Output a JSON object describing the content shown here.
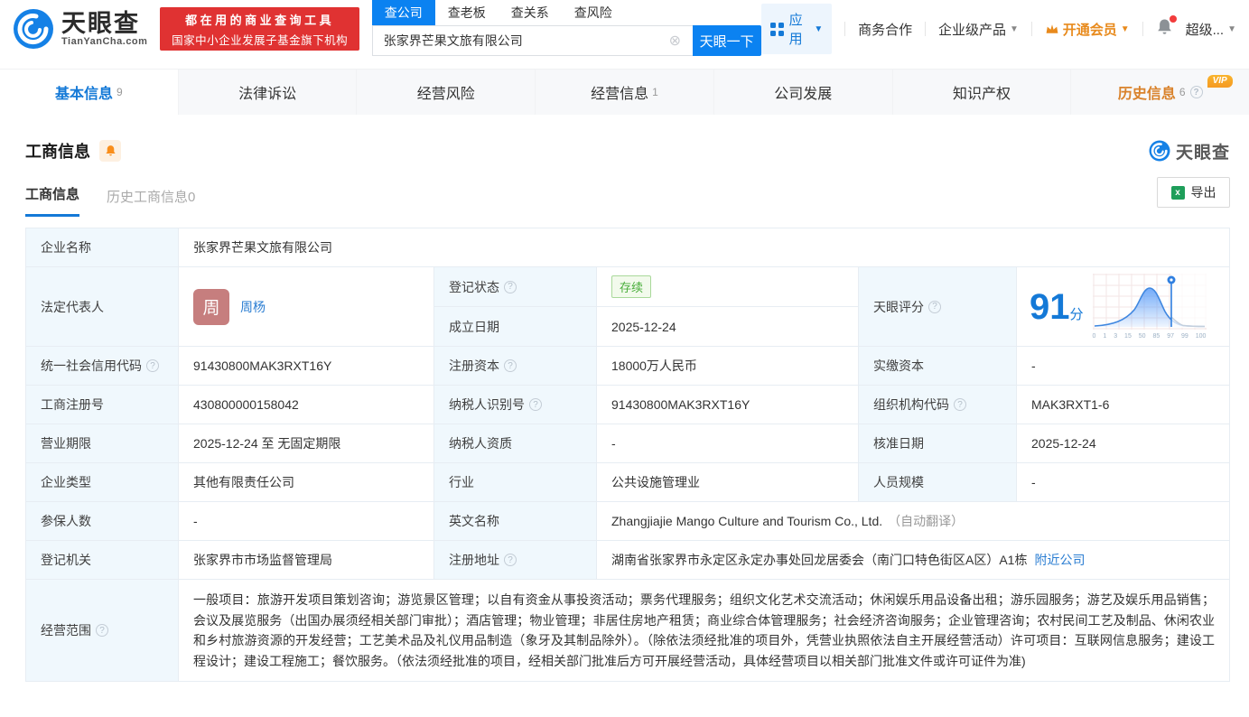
{
  "header": {
    "brand": {
      "name": "天眼查",
      "domain": "TianYanCha.com"
    },
    "promo": {
      "line1": "都在用的商业查询工具",
      "line2": "国家中小企业发展子基金旗下机构"
    },
    "search": {
      "tabs": [
        {
          "label": "查公司"
        },
        {
          "label": "查老板"
        },
        {
          "label": "查关系"
        },
        {
          "label": "查风险"
        }
      ],
      "value": "张家界芒果文旅有限公司",
      "button": "天眼一下"
    },
    "nav": {
      "apps": "应用",
      "biz_coop": "商务合作",
      "enterprise": "企业级产品",
      "vip": "开通会员",
      "super_vip": "超级..."
    }
  },
  "tabs": [
    {
      "label": "基本信息",
      "count": "9"
    },
    {
      "label": "法律诉讼",
      "count": ""
    },
    {
      "label": "经营风险",
      "count": ""
    },
    {
      "label": "经营信息",
      "count": "1"
    },
    {
      "label": "公司发展",
      "count": ""
    },
    {
      "label": "知识产权",
      "count": ""
    },
    {
      "label": "历史信息",
      "count": "6"
    }
  ],
  "vip_badge": "VIP",
  "section": {
    "title": "工商信息",
    "subtab_active": "工商信息",
    "subtab_history": "历史工商信息0",
    "export": "导出",
    "watermark": "天眼查",
    "excel_icon": "x"
  },
  "info": {
    "company_name_label": "企业名称",
    "company_name": "张家界芒果文旅有限公司",
    "legal_rep_label": "法定代表人",
    "legal_rep_avatar": "周",
    "legal_rep": "周杨",
    "reg_status_label": "登记状态",
    "reg_status": "存续",
    "est_date_label": "成立日期",
    "est_date": "2025-12-24",
    "score_label": "天眼评分",
    "score": {
      "value": "91",
      "unit": "分",
      "ticks": [
        "0",
        "1",
        "3",
        "15",
        "50",
        "85",
        "97",
        "99",
        "100"
      ]
    },
    "uscc_label": "统一社会信用代码",
    "uscc": "91430800MAK3RXT16Y",
    "reg_capital_label": "注册资本",
    "reg_capital": "18000万人民币",
    "paid_capital_label": "实缴资本",
    "paid_capital": "-",
    "reg_no_label": "工商注册号",
    "reg_no": "430800000158042",
    "taxpayer_id_label": "纳税人识别号",
    "taxpayer_id": "91430800MAK3RXT16Y",
    "org_code_label": "组织机构代码",
    "org_code": "MAK3RXT1-6",
    "biz_term_label": "营业期限",
    "biz_term": "2025-12-24 至 无固定期限",
    "taxpayer_qual_label": "纳税人资质",
    "taxpayer_qual": "-",
    "approval_date_label": "核准日期",
    "approval_date": "2025-12-24",
    "company_type_label": "企业类型",
    "company_type": "其他有限责任公司",
    "industry_label": "行业",
    "industry": "公共设施管理业",
    "staff_size_label": "人员规模",
    "staff_size": "-",
    "insured_label": "参保人数",
    "insured": "-",
    "en_name_label": "英文名称",
    "en_name": "Zhangjiajie Mango Culture and Tourism Co., Ltd.",
    "en_name_note": "（自动翻译）",
    "reg_authority_label": "登记机关",
    "reg_authority": "张家界市市场监督管理局",
    "reg_addr_label": "注册地址",
    "reg_addr": "湖南省张家界市永定区永定办事处回龙居委会（南门口特色街区A区）A1栋",
    "nearby_link": "附近公司",
    "scope_label": "经营范围",
    "scope": "一般项目：旅游开发项目策划咨询；游览景区管理；以自有资金从事投资活动；票务代理服务；组织文化艺术交流活动；休闲娱乐用品设备出租；游乐园服务；游艺及娱乐用品销售；会议及展览服务（出国办展须经相关部门审批）；酒店管理；物业管理；非居住房地产租赁；商业综合体管理服务；社会经济咨询服务；企业管理咨询；农村民间工艺及制品、休闲农业和乡村旅游资源的开发经营；工艺美术品及礼仪用品制造（象牙及其制品除外）。（除依法须经批准的项目外，凭营业执照依法自主开展经营活动）许可项目：互联网信息服务；建设工程设计；建设工程施工；餐饮服务。（依法须经批准的项目，经相关部门批准后方可开展经营活动，具体经营项目以相关部门批准文件或许可证件为准)"
  },
  "colors": {
    "primary_blue": "#0b82f1",
    "link_blue": "#2a7dd2",
    "brand_red": "#e03232",
    "status_green": "#48ad3a",
    "vip_orange": "#e88a1c",
    "hist_orange": "#d9822b"
  }
}
